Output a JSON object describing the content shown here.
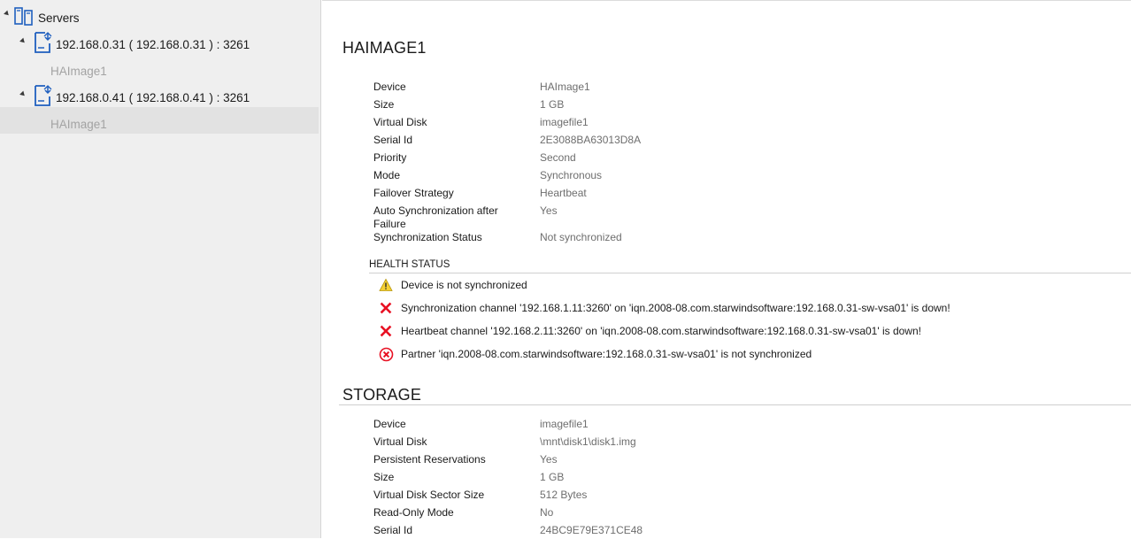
{
  "tree": {
    "root_label": "Servers",
    "servers": [
      {
        "label": "192.168.0.31 ( 192.168.0.31 ) : 3261",
        "devices": [
          "HAImage1"
        ]
      },
      {
        "label": "192.168.0.41 ( 192.168.0.41 ) : 3261",
        "devices": [
          "HAImage1"
        ]
      }
    ]
  },
  "device_section": {
    "title": "HAIMAGE1",
    "properties": [
      {
        "name": "Device",
        "value": "HAImage1"
      },
      {
        "name": "Size",
        "value": "1 GB"
      },
      {
        "name": "Virtual Disk",
        "value": "imagefile1"
      },
      {
        "name": "Serial Id",
        "value": "2E3088BA63013D8A"
      },
      {
        "name": "Priority",
        "value": "Second"
      },
      {
        "name": "Mode",
        "value": "Synchronous"
      },
      {
        "name": "Failover Strategy",
        "value": "Heartbeat"
      },
      {
        "name": "Auto Synchronization after Failure",
        "value": "Yes"
      },
      {
        "name": "Synchronization Status",
        "value": "Not synchronized"
      }
    ]
  },
  "health": {
    "heading": "HEALTH STATUS",
    "items": [
      {
        "icon": "warning-icon",
        "text": "Device is not synchronized"
      },
      {
        "icon": "red-x-icon",
        "text": "Synchronization channel '192.168.1.11:3260' on 'iqn.2008-08.com.starwindsoftware:192.168.0.31-sw-vsa01' is down!"
      },
      {
        "icon": "red-x-icon",
        "text": "Heartbeat channel '192.168.2.11:3260' on 'iqn.2008-08.com.starwindsoftware:192.168.0.31-sw-vsa01' is down!"
      },
      {
        "icon": "error-circle-icon",
        "text": "Partner 'iqn.2008-08.com.starwindsoftware:192.168.0.31-sw-vsa01' is not synchronized"
      }
    ]
  },
  "storage_section": {
    "title": "STORAGE",
    "properties": [
      {
        "name": "Device",
        "value": "imagefile1"
      },
      {
        "name": "Virtual Disk",
        "value": "\\mnt\\disk1\\disk1.img"
      },
      {
        "name": "Persistent Reservations",
        "value": "Yes"
      },
      {
        "name": "Size",
        "value": "1 GB"
      },
      {
        "name": "Virtual Disk Sector Size",
        "value": "512 Bytes"
      },
      {
        "name": "Read-Only Mode",
        "value": "No"
      },
      {
        "name": "Serial Id",
        "value": "24BC9E79E371CE48"
      }
    ]
  },
  "colors": {
    "icon_blue": "#1f5fbf",
    "error_red": "#e81123",
    "warning_yellow": "#f5d033",
    "dim_text": "#a3a3a3"
  }
}
